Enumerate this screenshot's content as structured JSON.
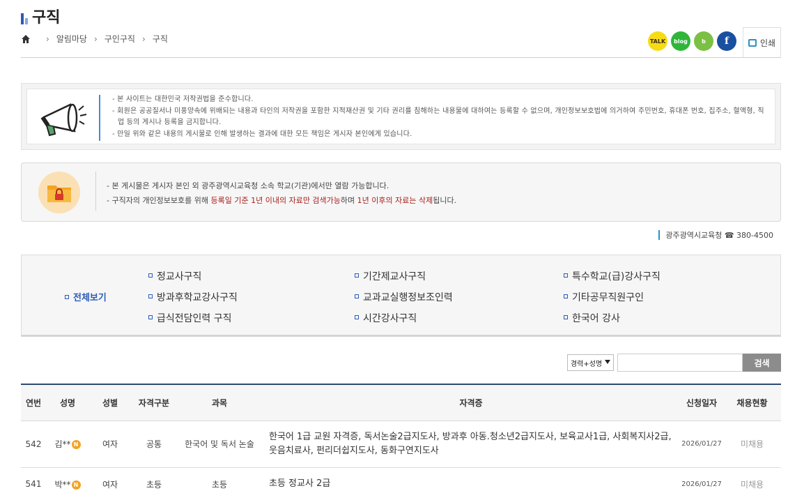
{
  "page": {
    "title": "구직"
  },
  "breadcrumb": {
    "items": [
      "알림마당",
      "구인구직",
      "구직"
    ]
  },
  "share": {
    "kakao": "TALK",
    "blog": "blog",
    "band": "b",
    "facebook": "f"
  },
  "print": {
    "label": "인쇄"
  },
  "notice1": {
    "lines": [
      "- 본 사이트는 대한민국 저작권법을 준수합니다.",
      "- 회원은 공공질서나 미풍양속에 위배되는 내용과 타인의 저작권을 포함한 지적재산권 및 기타 권리를 침해하는 내용물에 대하여는 등록할 수 없으며, 개인정보보호법에 의거하여 주민번호, 휴대폰 번호, 집주소, 혈액형, 직업 등의 게시나 등록을 금지합니다.",
      "- 만일 위와 같은 내용의 게시물로 인해 발생하는 결과에 대한 모든 책임은 게시자 본인에게 있습니다."
    ]
  },
  "notice2": {
    "line1": "- 본 게시물은 게시자 본인 외 광주광역시교육청 소속 학교(기관)에서만 열람 가능합니다.",
    "line2_a": "- 구직자의 개인정보보호를 위해 ",
    "line2_b": "등록일 기준 1년 이내의 자료만 검색가능",
    "line2_c": "하며 ",
    "line2_d": "1년 이후의 자료는 삭제",
    "line2_e": "됩니다."
  },
  "contact": {
    "org": "광주광역시교육청",
    "phone": "☎ 380-4500"
  },
  "categories": {
    "all": "전체보기",
    "items": [
      "정교사구직",
      "기간제교사구직",
      "특수학교(급)강사구직",
      "방과후학교강사구직",
      "교과교실행정보조인력",
      "기타공무직원구인",
      "급식전담인력 구직",
      "시간강사구직",
      "한국어 강사"
    ]
  },
  "search": {
    "select_value": "경력+성명",
    "input_value": "",
    "button_label": "검색"
  },
  "table": {
    "headers": [
      "연번",
      "성명",
      "성별",
      "자격구분",
      "과목",
      "자격증",
      "신청일자",
      "채용현황"
    ],
    "rows": [
      {
        "no": "542",
        "name": "김**",
        "badge": "N",
        "gender": "여자",
        "type": "공통",
        "subject": "한국어 및 독서 논술",
        "qual": "한국어 1급 교원 자격증, 독서논술2급지도사, 방과후 아동.청소년2급지도사, 보육교사1급, 사회복지사2급, 웃음치료사, 펀리더쉽지도사, 동화구연지도사",
        "date": "2026/01/27",
        "status": "미채용"
      },
      {
        "no": "541",
        "name": "박**",
        "badge": "N",
        "gender": "여자",
        "type": "초등",
        "subject": "초등",
        "qual": "초등 정교사 2급",
        "date": "2026/01/27",
        "status": "미채용"
      }
    ]
  }
}
